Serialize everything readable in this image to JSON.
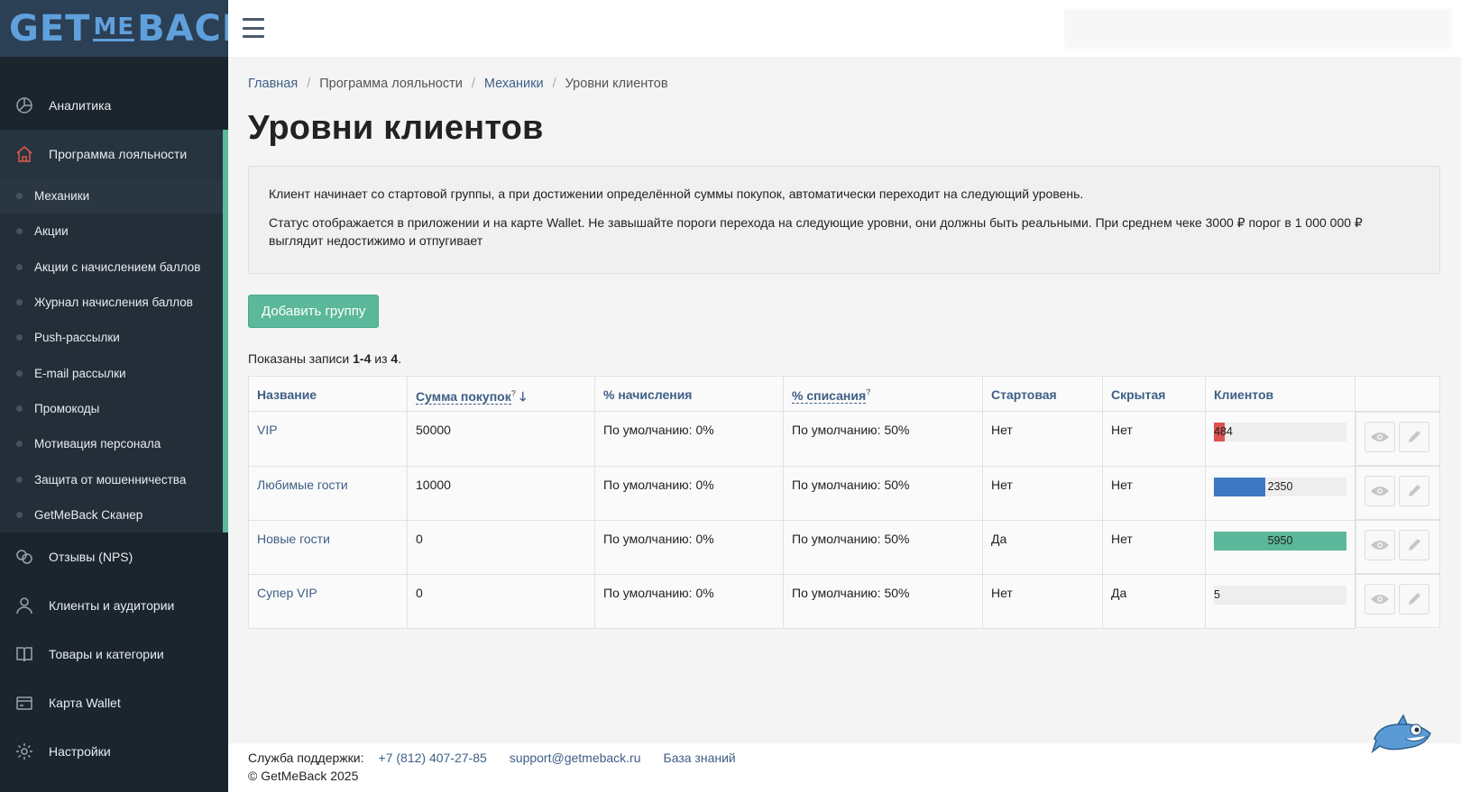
{
  "app": {
    "logo_left": "GET",
    "logo_me": "ME",
    "logo_right": "BACK"
  },
  "sidebar": {
    "items_top": [
      {
        "label": "Аналитика",
        "icon": "chart-pie-icon"
      },
      {
        "label": "Программа лояльности",
        "icon": "home-icon",
        "active": true
      }
    ],
    "subitems": [
      {
        "label": "Механики",
        "active": true
      },
      {
        "label": "Акции"
      },
      {
        "label": "Акции с начислением баллов"
      },
      {
        "label": "Журнал начисления баллов"
      },
      {
        "label": "Push-рассылки"
      },
      {
        "label": "E-mail рассылки"
      },
      {
        "label": "Промокоды"
      },
      {
        "label": "Мотивация персонала"
      },
      {
        "label": "Защита от мошенничества"
      },
      {
        "label": "GetMeBack Сканер"
      }
    ],
    "items_bottom": [
      {
        "label": "Отзывы (NPS)",
        "icon": "chat-icon"
      },
      {
        "label": "Клиенты и аудитории",
        "icon": "user-icon"
      },
      {
        "label": "Товары и категории",
        "icon": "book-icon"
      },
      {
        "label": "Карта Wallet",
        "icon": "wallet-card-icon"
      },
      {
        "label": "Настройки",
        "icon": "gear-icon"
      }
    ]
  },
  "breadcrumb": [
    {
      "label": "Главная",
      "link": true
    },
    {
      "label": "Программа лояльности",
      "link": false
    },
    {
      "label": "Механики",
      "link": true
    },
    {
      "label": "Уровни клиентов",
      "link": false
    }
  ],
  "page_title": "Уровни клиентов",
  "info": {
    "p1": "Клиент начинает со стартовой группы, а при достижении определённой суммы покупок, автоматически переходит на следующий уровень.",
    "p2": "Статус отображается в приложении и на карте Wallet. Не завышайте пороги перехода на следующие уровни, они должны быть реальными. При среднем чеке 3000 ₽ порог в 1 000 000 ₽ выглядит недостижимо и отпугивает"
  },
  "add_button": "Добавить группу",
  "summary": {
    "prefix": "Показаны записи ",
    "range": "1-4",
    "mid": " из ",
    "total": "4",
    "suffix": "."
  },
  "table": {
    "headers": {
      "name": "Название",
      "sum": "Сумма покупок",
      "accrual": "% начисления",
      "writeoff": "% списания",
      "start": "Стартовая",
      "hidden": "Скрытая",
      "clients": "Клиентов"
    },
    "rows": [
      {
        "name": "VIP",
        "sum": "50000",
        "accrual": "По умолчанию: 0%",
        "writeoff": "По умолчанию: 50%",
        "start": "Нет",
        "hidden": "Нет",
        "clients": "484",
        "fill": 0.08,
        "color": "#d9534f",
        "align": "left"
      },
      {
        "name": "Любимые гости",
        "sum": "10000",
        "accrual": "По умолчанию: 0%",
        "writeoff": "По умолчанию: 50%",
        "start": "Нет",
        "hidden": "Нет",
        "clients": "2350",
        "fill": 0.39,
        "color": "#3e78c2",
        "align": "center"
      },
      {
        "name": "Новые гости",
        "sum": "0",
        "accrual": "По умолчанию: 0%",
        "writeoff": "По умолчанию: 50%",
        "start": "Да",
        "hidden": "Нет",
        "clients": "5950",
        "fill": 1.0,
        "color": "#5bb89a",
        "align": "center"
      },
      {
        "name": "Супер VIP",
        "sum": "0",
        "accrual": "По умолчанию: 0%",
        "writeoff": "По умолчанию: 50%",
        "start": "Нет",
        "hidden": "Да",
        "clients": "5",
        "fill": 0.0,
        "color": "#d9534f",
        "align": "left"
      }
    ]
  },
  "footer": {
    "support_label": "Служба поддержки:",
    "phone": "+7 (812) 407-27-85",
    "email": "support@getmeback.ru",
    "kb": "База знаний",
    "copyright": "© GetMeBack 2025"
  }
}
